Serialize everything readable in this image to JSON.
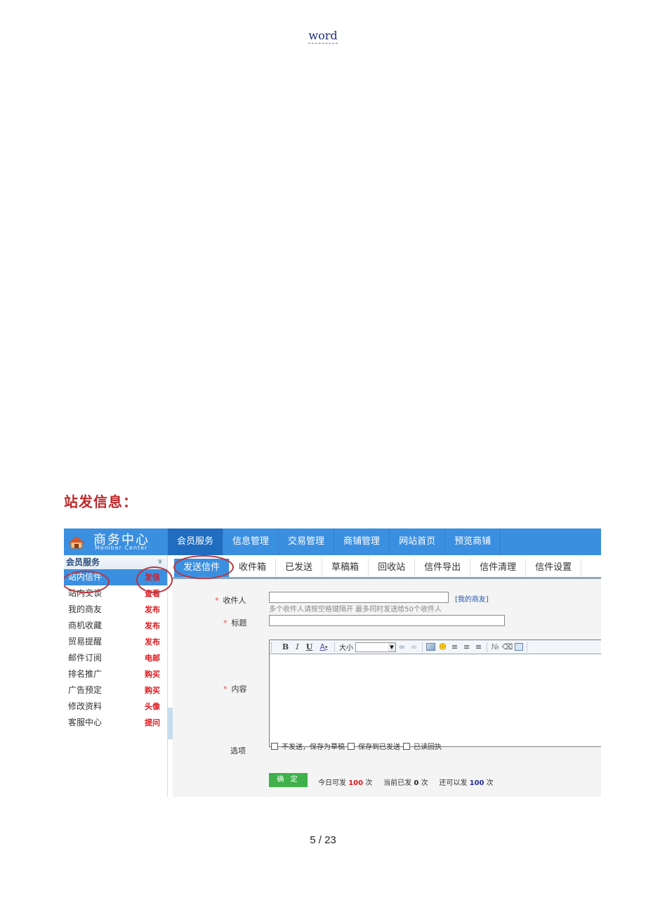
{
  "document": {
    "header": "word",
    "section_title": "站发信息：",
    "page_number": "5",
    "page_total": "/ 23"
  },
  "app": {
    "brand_title": "商务中心",
    "brand_subtitle": "Member Center",
    "brand_icon": "home-icon",
    "accent_color": "#3b8fe0",
    "nav": [
      {
        "label": "会员服务",
        "active": true
      },
      {
        "label": "信息管理"
      },
      {
        "label": "交易管理"
      },
      {
        "label": "商铺管理"
      },
      {
        "label": "网站首页"
      },
      {
        "label": "预览商铺"
      }
    ]
  },
  "sidebar": {
    "heading": "会员服务",
    "items": [
      {
        "label": "站内信件",
        "action": "发信",
        "active": true
      },
      {
        "label": "站内交谈",
        "action": "查看"
      },
      {
        "label": "我的商友",
        "action": "发布"
      },
      {
        "label": "商机收藏",
        "action": "发布"
      },
      {
        "label": "贸易提醒",
        "action": "发布"
      },
      {
        "label": "邮件订阅",
        "action": "电邮"
      },
      {
        "label": "排名推广",
        "action": "购买"
      },
      {
        "label": "广告预定",
        "action": "购买"
      },
      {
        "label": "修改资料",
        "action": "头像"
      },
      {
        "label": "客服中心",
        "action": "提问"
      }
    ]
  },
  "tabs": [
    {
      "label": "发送信件",
      "active": true
    },
    {
      "label": "收件箱"
    },
    {
      "label": "已发送"
    },
    {
      "label": "草稿箱"
    },
    {
      "label": "回收站"
    },
    {
      "label": "信件导出"
    },
    {
      "label": "信件清理"
    },
    {
      "label": "信件设置"
    }
  ],
  "form": {
    "required_mark": "*",
    "recipient_label": "收件人",
    "recipient_value": "",
    "friends_link": "[我的商友]",
    "recipient_hint": "多个收件人请按空格键隔开 最多同时发送给50个收件人",
    "subject_label": "标题",
    "subject_value": "",
    "content_label": "内容",
    "content_value": "",
    "toolbar": {
      "bold": "B",
      "italic": "I",
      "underline": "U",
      "font_color": "A",
      "size_label": "大小",
      "size_value": ""
    },
    "options_label": "选项",
    "options": [
      {
        "label": "不发送，保存为草稿",
        "checked": false
      },
      {
        "label": "保存到已发送",
        "checked": false
      },
      {
        "label": "已读回执",
        "checked": false
      }
    ],
    "submit_label": "确 定",
    "stats": {
      "today_label": "今日可发",
      "today_value": "100",
      "today_unit": "次",
      "sent_label": "当前已发",
      "sent_value": "0",
      "sent_unit": "次",
      "remain_label": "还可以发",
      "remain_value": "100",
      "remain_unit": "次"
    }
  }
}
